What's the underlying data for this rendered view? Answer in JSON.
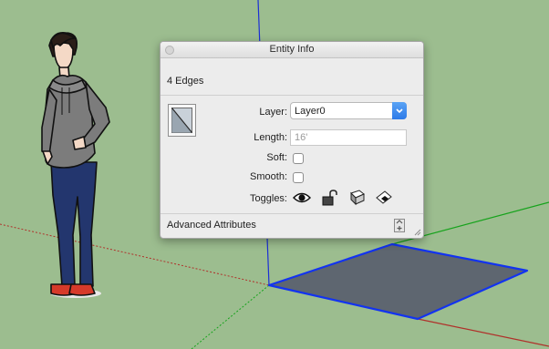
{
  "panel": {
    "title": "Entity Info",
    "summary": "4 Edges",
    "layer_label": "Layer:",
    "layer_value": "Layer0",
    "length_label": "Length:",
    "length_value": "16'",
    "soft_label": "Soft:",
    "soft_checked": false,
    "smooth_label": "Smooth:",
    "smooth_checked": false,
    "toggles_label": "Toggles:",
    "toggles": [
      "eye-icon",
      "lock-icon",
      "cast-shadows-icon",
      "receive-shadows-icon"
    ],
    "advanced_label": "Advanced Attributes"
  },
  "scene": {
    "background_color": "#9cbd8f",
    "axis_colors": {
      "red": "#b0302a",
      "green": "#16a31c",
      "blue": "#1b2fd6"
    },
    "face_color": "#5e6670",
    "edge_color": "#1233f0"
  },
  "colors": {
    "accent": "#2d7ae8"
  }
}
